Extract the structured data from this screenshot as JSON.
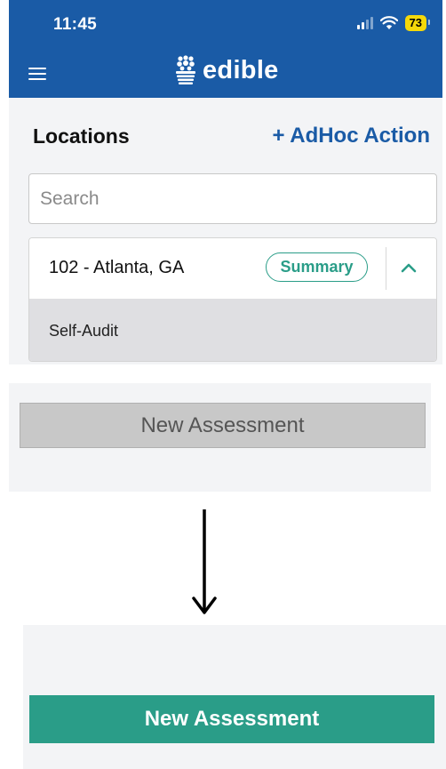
{
  "status_bar": {
    "time": "11:45",
    "battery": "73"
  },
  "header": {
    "brand_name": "edible"
  },
  "locations": {
    "title": "Locations",
    "adhoc_action_label": "+ AdHoc Action",
    "search_placeholder": "Search",
    "card": {
      "location_name": "102 - Atlanta, GA",
      "summary_label": "Summary",
      "audit_label": "Self-Audit"
    }
  },
  "before": {
    "button_label": "New Assessment"
  },
  "after": {
    "button_label": "New Assessment"
  },
  "colors": {
    "brand_blue": "#1a5ba6",
    "accent_green": "#2a9d88",
    "disabled_gray": "#c8c8c8",
    "battery_yellow": "#f5d90a"
  }
}
